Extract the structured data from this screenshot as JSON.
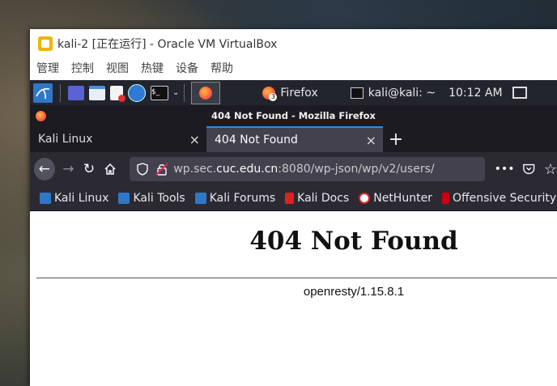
{
  "vbox": {
    "title": "kali-2 [正在运行] - Oracle VM VirtualBox",
    "menu": [
      "管理",
      "控制",
      "视图",
      "热键",
      "设备",
      "帮助"
    ]
  },
  "panel": {
    "firefox_task": "Firefox",
    "firefox_badge": "3",
    "terminal_task": "kali@kali: ~",
    "clock": "10:12 AM"
  },
  "firefox": {
    "window_title": "404 Not Found - Mozilla Firefox",
    "tabs": [
      {
        "label": "Kali Linux",
        "close": "×"
      },
      {
        "label": "404 Not Found",
        "close": "×"
      }
    ],
    "new_tab": "+",
    "url_prefix": "wp.sec.",
    "url_host": "cuc.edu.cn",
    "url_suffix": ":8080/wp-json/wp/v2/users/",
    "page_actions": "•••",
    "bookmarks": [
      "Kali Linux",
      "Kali Tools",
      "Kali Forums",
      "Kali Docs",
      "NetHunter",
      "Offensive Security"
    ]
  },
  "page": {
    "heading": "404 Not Found",
    "server": "openresty/1.15.8.1"
  },
  "colors": {
    "accent": "#2a8bde",
    "panel": "#23252e",
    "toolbar": "#2b2a33"
  }
}
